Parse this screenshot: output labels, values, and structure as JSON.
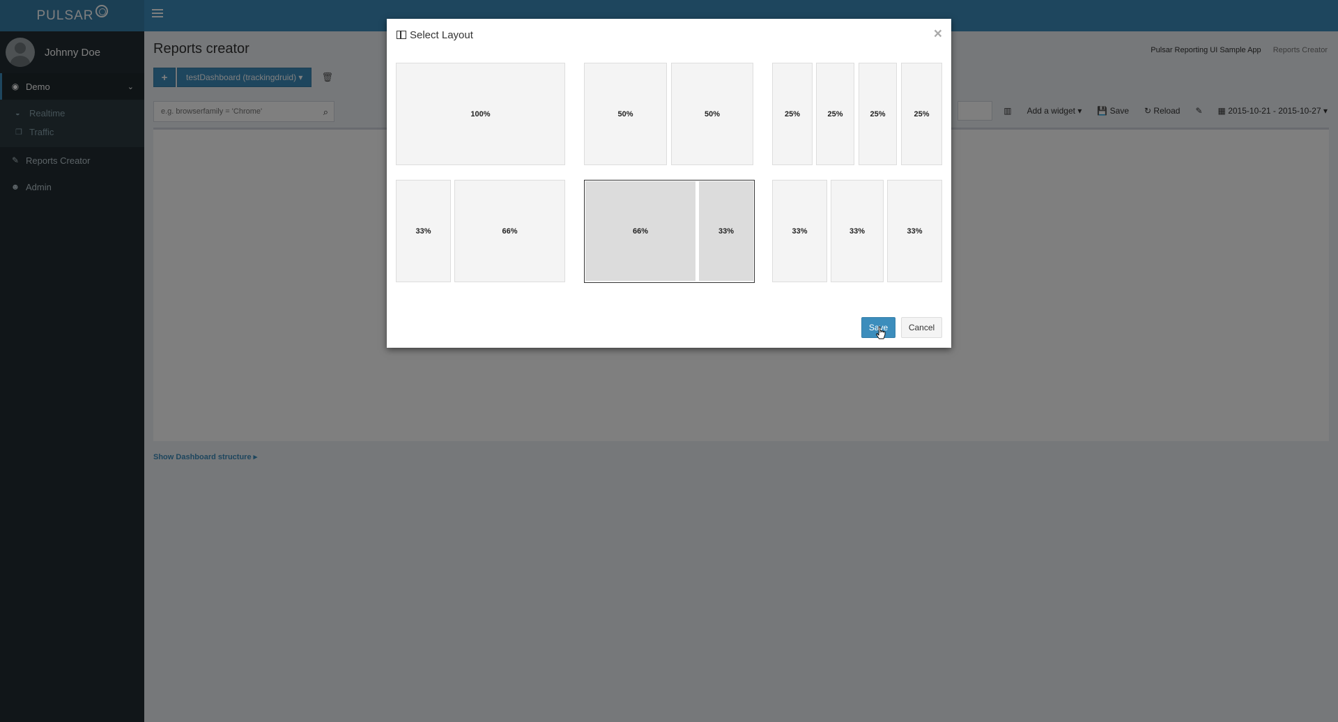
{
  "app": {
    "logo_text": "PULSAR"
  },
  "sidebar": {
    "user_name": "Johnny Doe",
    "items": [
      {
        "label": "Demo",
        "icon": "circle-dot-icon"
      },
      {
        "label": "Realtime",
        "icon": "dashboard-icon"
      },
      {
        "label": "Traffic",
        "icon": "cubes-icon"
      },
      {
        "label": "Reports Creator",
        "icon": "pencil-icon"
      },
      {
        "label": "Admin",
        "icon": "users-icon"
      }
    ]
  },
  "content": {
    "page_title": "Reports creator",
    "breadcrumb": [
      "Pulsar Reporting UI Sample App",
      "Reports Creator"
    ],
    "dashboard_button": "testDashboard (trackingdruid) ▾",
    "plus_label": "+",
    "filter_placeholder": "e.g. browserfamily = 'Chrome'",
    "toolbar": {
      "add_widget": "Add a widget ▾",
      "save": "Save",
      "reload": "Reload",
      "date_range": "2015-10-21 - 2015-10-27 ▾"
    },
    "show_structure": "Show Dashboard structure ▸"
  },
  "modal": {
    "title": "Select Layout",
    "close": "×",
    "layouts": [
      {
        "columns": [
          "100%"
        ],
        "selected": false
      },
      {
        "columns": [
          "50%",
          "50%"
        ],
        "selected": false
      },
      {
        "columns": [
          "25%",
          "25%",
          "25%",
          "25%"
        ],
        "selected": false
      },
      {
        "columns": [
          "33%",
          "66%"
        ],
        "selected": false
      },
      {
        "columns": [
          "66%",
          "33%"
        ],
        "selected": true
      },
      {
        "columns": [
          "33%",
          "33%",
          "33%"
        ],
        "selected": false
      }
    ],
    "save_label": "Save",
    "cancel_label": "Cancel"
  }
}
